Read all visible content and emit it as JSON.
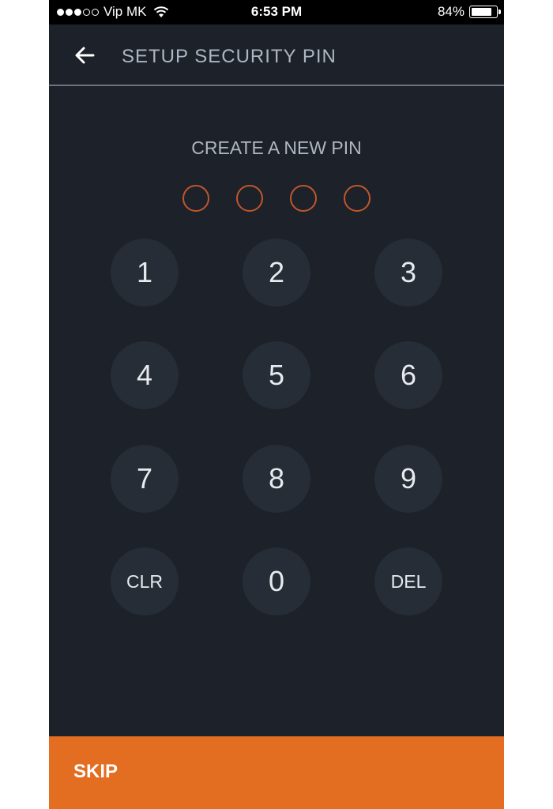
{
  "status_bar": {
    "carrier": "Vip MK",
    "time": "6:53 PM",
    "battery_percent": "84%",
    "battery_level": 0.84,
    "signal_bars_filled": 3,
    "signal_bars_total": 5
  },
  "header": {
    "title": "SETUP SECURITY PIN",
    "back_icon": "arrow-left-icon"
  },
  "prompt": {
    "text": "CREATE A NEW PIN",
    "digits_total": 4,
    "digits_entered": 0
  },
  "keypad": {
    "keys": [
      "1",
      "2",
      "3",
      "4",
      "5",
      "6",
      "7",
      "8",
      "9",
      "CLR",
      "0",
      "DEL"
    ]
  },
  "footer": {
    "skip_label": "SKIP"
  },
  "colors": {
    "background": "#1c212a",
    "key_background": "#272d36",
    "accent": "#e36d20",
    "pin_dot_border": "#c2562a",
    "text_muted": "#aeb6c2"
  }
}
